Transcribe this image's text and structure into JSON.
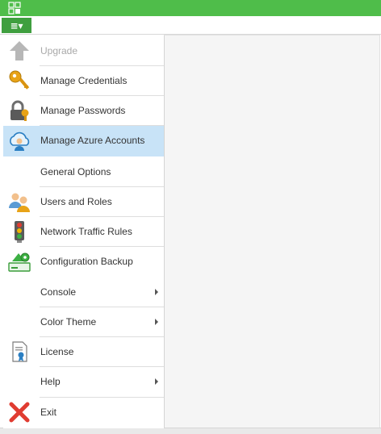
{
  "window": {
    "app_icon": "app-grid-icon"
  },
  "menubar": {
    "menu_button_icon": "hamburger-menu-icon",
    "menu_button_glyph": "≡▾"
  },
  "menu": {
    "items": [
      {
        "label": "Upgrade",
        "icon": "upgrade-arrow-icon",
        "disabled": true
      },
      {
        "label": "Manage Credentials",
        "icon": "key-icon"
      },
      {
        "label": "Manage Passwords",
        "icon": "lock-key-icon"
      },
      {
        "label": "Manage Azure Accounts",
        "icon": "azure-cloud-icon",
        "selected": true
      },
      {
        "label": "General Options",
        "icon": ""
      },
      {
        "label": "Users and Roles",
        "icon": "users-icon"
      },
      {
        "label": "Network Traffic Rules",
        "icon": "traffic-light-icon"
      },
      {
        "label": "Configuration Backup",
        "icon": "config-backup-icon"
      },
      {
        "label": "Console",
        "icon": "",
        "submenu": true
      },
      {
        "label": "Color Theme",
        "icon": "",
        "submenu": true
      },
      {
        "label": "License",
        "icon": "license-icon"
      },
      {
        "label": "Help",
        "icon": "",
        "submenu": true
      },
      {
        "label": "Exit",
        "icon": "exit-x-icon"
      }
    ]
  },
  "colors": {
    "titlebar": "#4fbd4a",
    "menu_button": "#3f9f3f",
    "selected_item": "#c8e3f7",
    "exit_red": "#e03c31"
  }
}
